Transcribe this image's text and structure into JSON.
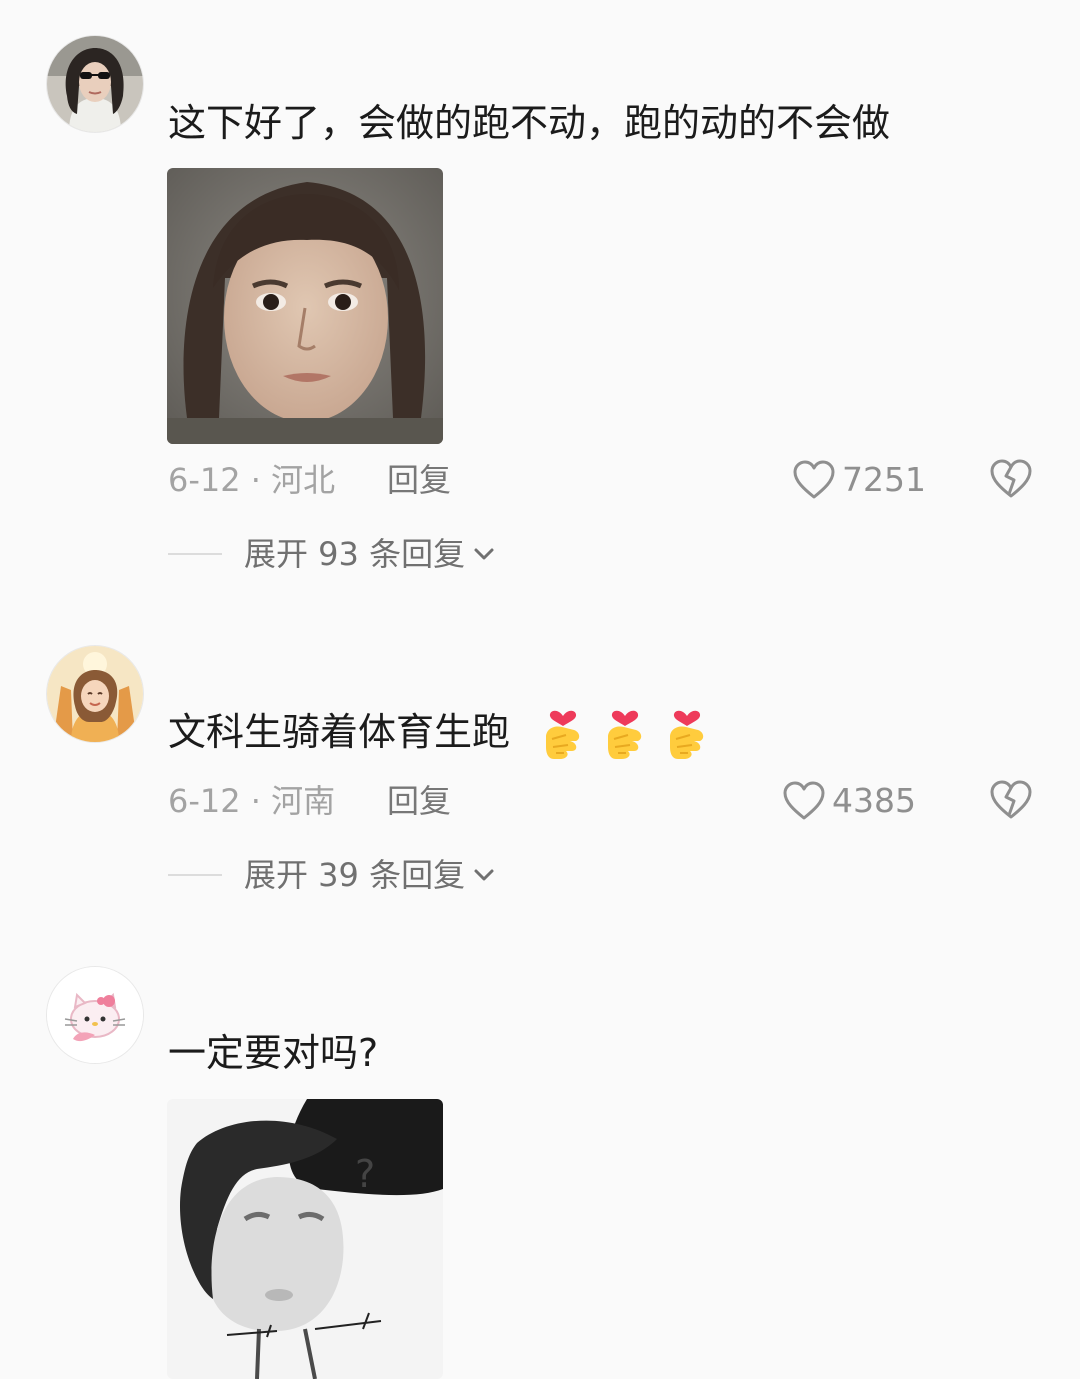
{
  "comments": [
    {
      "avatar_icon": "avatar-woman-sunglasses",
      "text": "这下好了，会做的跑不动，跑的动的不会做",
      "image": "meme-woman-stare",
      "date_location": "6-12 · 河北",
      "reply_label": "回复",
      "like_count": "7251",
      "expand_label": "展开 93 条回复"
    },
    {
      "avatar_icon": "avatar-cartoon-girl",
      "text": "文科生骑着体育生跑",
      "emojis": [
        "finger-heart-emoji",
        "finger-heart-emoji",
        "finger-heart-emoji"
      ],
      "date_location": "6-12 · 河南",
      "reply_label": "回复",
      "like_count": "4385",
      "expand_label": "展开 39 条回复"
    },
    {
      "avatar_icon": "avatar-hello-kitty",
      "text": "一定要对吗?",
      "image": "meme-confused-sketch"
    }
  ],
  "colors": {
    "background": "#fafafa",
    "text": "#1b1b1b",
    "meta": "#a3a3a3",
    "icon": "#8f8f8f"
  }
}
